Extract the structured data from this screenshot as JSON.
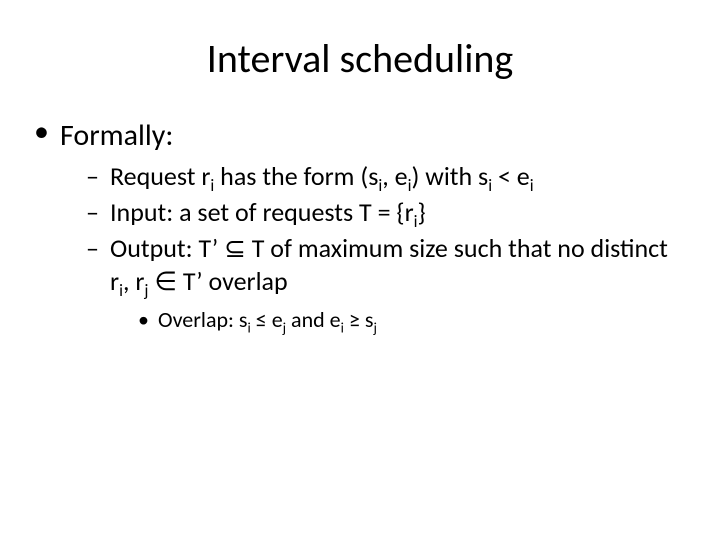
{
  "title": "Interval scheduling",
  "bullets": {
    "l1": "Formally:",
    "l2a_html": "Request r<sub>i</sub> has the form (s<sub>i</sub>, e<sub>i</sub>) with s<sub>i</sub> < e<sub>i</sub>",
    "l2b_html": "Input: a set of requests T = {r<sub>i</sub>}",
    "l2c_html": "Output: T’ ⊆ T of maximum size such that no distinct r<sub>i</sub>, r<sub>j</sub> ∈ T’ overlap",
    "l3a_html": "Overlap: s<sub>i</sub> ≤ e<sub>j</sub> and e<sub>i</sub> ≥ s<sub>j</sub>"
  }
}
